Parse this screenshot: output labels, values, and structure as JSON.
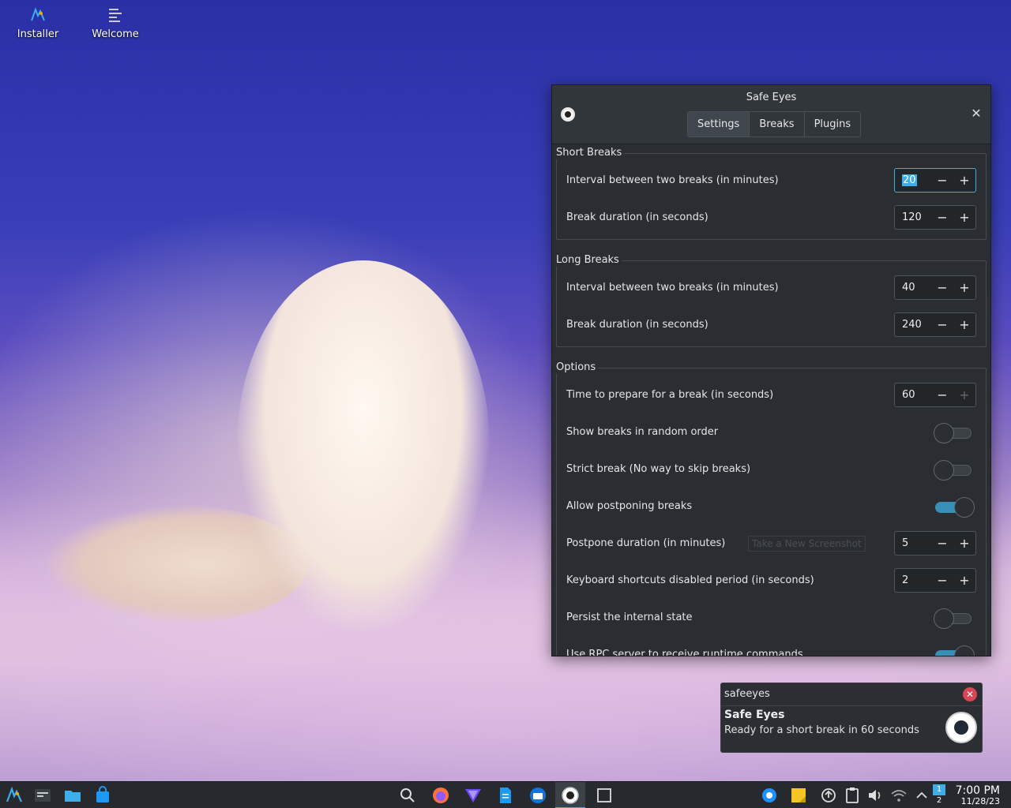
{
  "desktop": {
    "icons": [
      {
        "label": "Installer",
        "icon": "installer-icon"
      },
      {
        "label": "Welcome",
        "icon": "welcome-icon"
      }
    ]
  },
  "window": {
    "title": "Safe Eyes",
    "tabs": [
      {
        "label": "Settings",
        "active": true
      },
      {
        "label": "Breaks",
        "active": false
      },
      {
        "label": "Plugins",
        "active": false
      }
    ],
    "short_breaks": {
      "title": "Short Breaks",
      "interval_label": "Interval between two breaks (in minutes)",
      "interval_value": "20",
      "duration_label": "Break duration (in seconds)",
      "duration_value": "120"
    },
    "long_breaks": {
      "title": "Long Breaks",
      "interval_label": "Interval between two breaks (in minutes)",
      "interval_value": "40",
      "duration_label": "Break duration (in seconds)",
      "duration_value": "240"
    },
    "options": {
      "title": "Options",
      "prepare_label": "Time to prepare for a break (in seconds)",
      "prepare_value": "60",
      "random_label": "Show breaks in random order",
      "random_on": false,
      "strict_label": "Strict break (No way to skip breaks)",
      "strict_on": false,
      "postpone_allow_label": "Allow postponing breaks",
      "postpone_allow_on": true,
      "postpone_duration_label": "Postpone duration (in minutes)",
      "postpone_duration_value": "5",
      "ghost_button": "Take a New Screenshot",
      "keyboard_label": "Keyboard shortcuts disabled period (in seconds)",
      "keyboard_value": "2",
      "persist_label": "Persist the internal state",
      "persist_on": false,
      "rpc_label": "Use RPC server to receive runtime commands",
      "rpc_on": true
    }
  },
  "notification": {
    "app": "safeeyes",
    "title": "Safe Eyes",
    "body": "Ready for a short break in 60 seconds"
  },
  "taskbar": {
    "time": "7:00 PM",
    "date": "11/28/23",
    "pager": [
      "1",
      "2"
    ]
  },
  "colors": {
    "accent": "#3daee9",
    "window_bg": "#2a2e32",
    "taskbar_bg": "#262a2e"
  }
}
